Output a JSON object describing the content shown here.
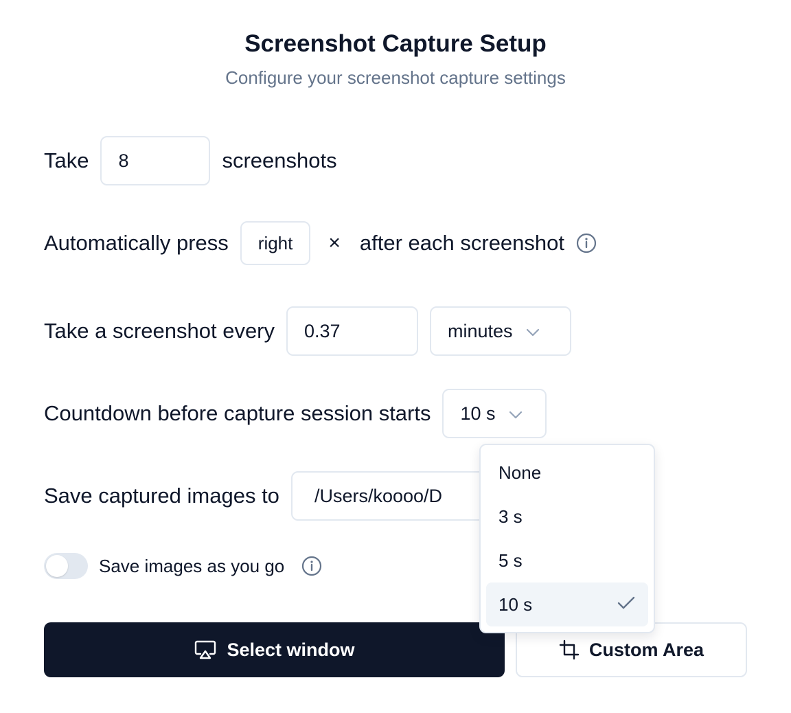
{
  "header": {
    "title": "Screenshot Capture Setup",
    "subtitle": "Configure your screenshot capture settings"
  },
  "count_row": {
    "prefix": "Take",
    "value": "8",
    "suffix": "screenshots"
  },
  "keypress_row": {
    "prefix": "Automatically press",
    "key": "right",
    "remove_symbol": "×",
    "suffix": "after each screenshot"
  },
  "interval_row": {
    "prefix": "Take a screenshot every",
    "value": "0.37",
    "unit": "minutes"
  },
  "countdown_row": {
    "label": "Countdown before capture session starts",
    "selected": "10 s",
    "options": [
      "None",
      "3 s",
      "5 s",
      "10 s"
    ]
  },
  "save_row": {
    "label": "Save captured images to",
    "path": "/Users/koooo/D"
  },
  "toggle_row": {
    "label": "Save images as you go",
    "enabled": false
  },
  "actions": {
    "select_window": "Select window",
    "custom_area": "Custom Area"
  },
  "colors": {
    "primary": "#0f172a",
    "border": "#e2e8f0",
    "muted": "#64748b",
    "selected_bg": "#f1f5f9"
  }
}
